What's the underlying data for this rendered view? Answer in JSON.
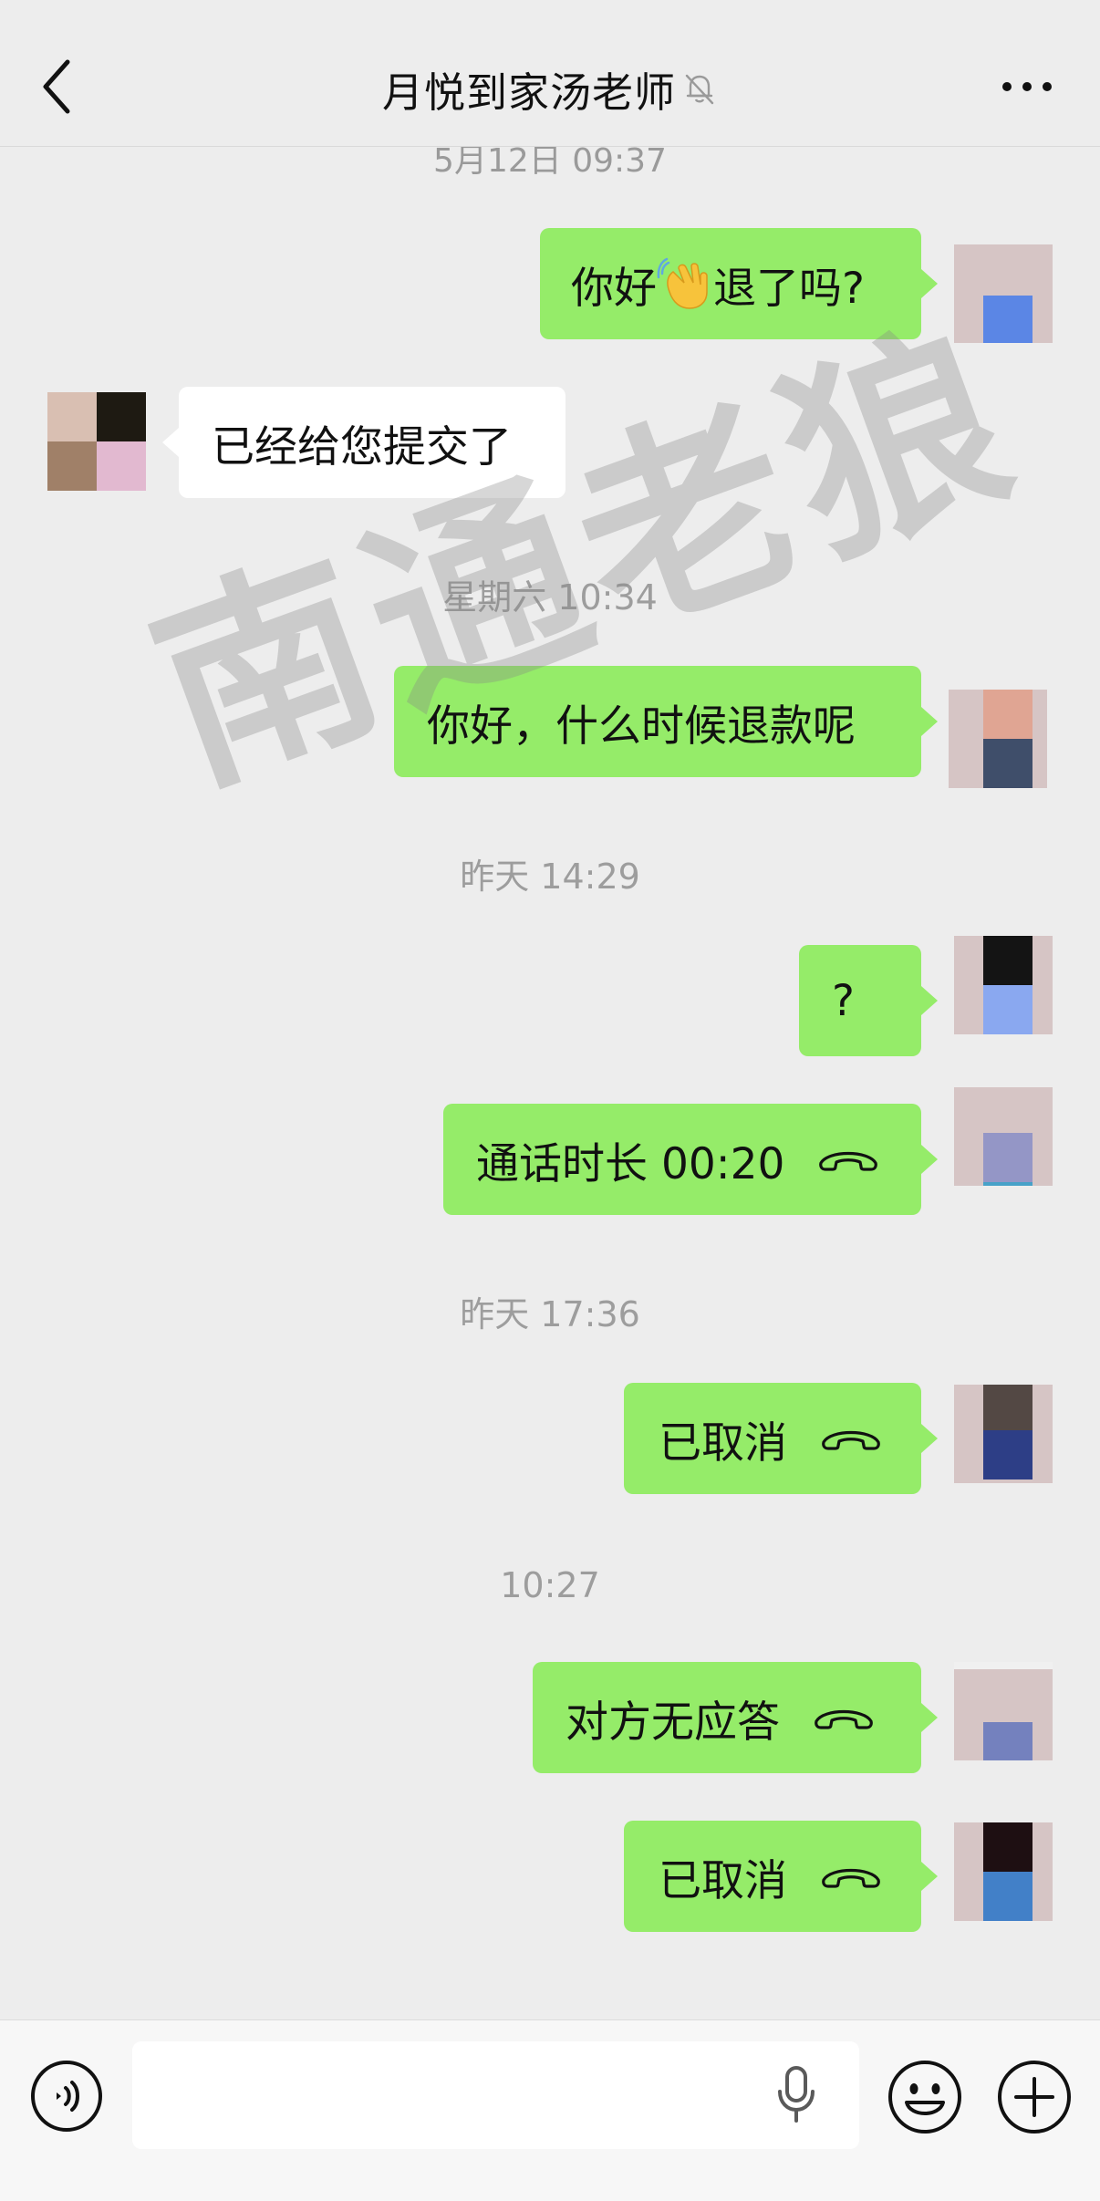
{
  "header": {
    "title": "月悦到家汤老师",
    "back_icon": "chevron-left-icon",
    "mute_icon": "bell-off-icon",
    "more_icon": "more-horizontal-icon"
  },
  "watermark": "南通老狼",
  "messages": [
    {
      "type": "time",
      "text": "5月12日 09:37"
    },
    {
      "type": "text",
      "from": "me",
      "before": "你好",
      "emoji": "waving-hand-emoji",
      "after": "退了吗?"
    },
    {
      "type": "text",
      "from": "them",
      "text": "已经给您提交了"
    },
    {
      "type": "time",
      "text": "星期六 10:34"
    },
    {
      "type": "text",
      "from": "me",
      "text": "你好，什么时候退款呢"
    },
    {
      "type": "time",
      "text": "昨天 14:29"
    },
    {
      "type": "text",
      "from": "me",
      "text": "?"
    },
    {
      "type": "call",
      "from": "me",
      "text": "通话时长 00:20",
      "icon": "phone-hangup-icon"
    },
    {
      "type": "time",
      "text": "昨天 17:36"
    },
    {
      "type": "call",
      "from": "me",
      "text": "已取消",
      "icon": "phone-hangup-icon"
    },
    {
      "type": "time",
      "text": "10:27"
    },
    {
      "type": "call",
      "from": "me",
      "text": "对方无应答",
      "icon": "phone-hangup-icon"
    },
    {
      "type": "call",
      "from": "me",
      "text": "已取消",
      "icon": "phone-hangup-icon"
    }
  ],
  "input_bar": {
    "voice_icon": "voice-wave-icon",
    "mic_icon": "microphone-icon",
    "emoji_icon": "smiley-face-icon",
    "plus_icon": "plus-circle-icon",
    "placeholder": ""
  },
  "colors": {
    "background": "#ededed",
    "my_bubble": "#95ec69",
    "their_bubble": "#ffffff",
    "timestamp_text": "#9d9d9d",
    "watermark": "#878787"
  }
}
